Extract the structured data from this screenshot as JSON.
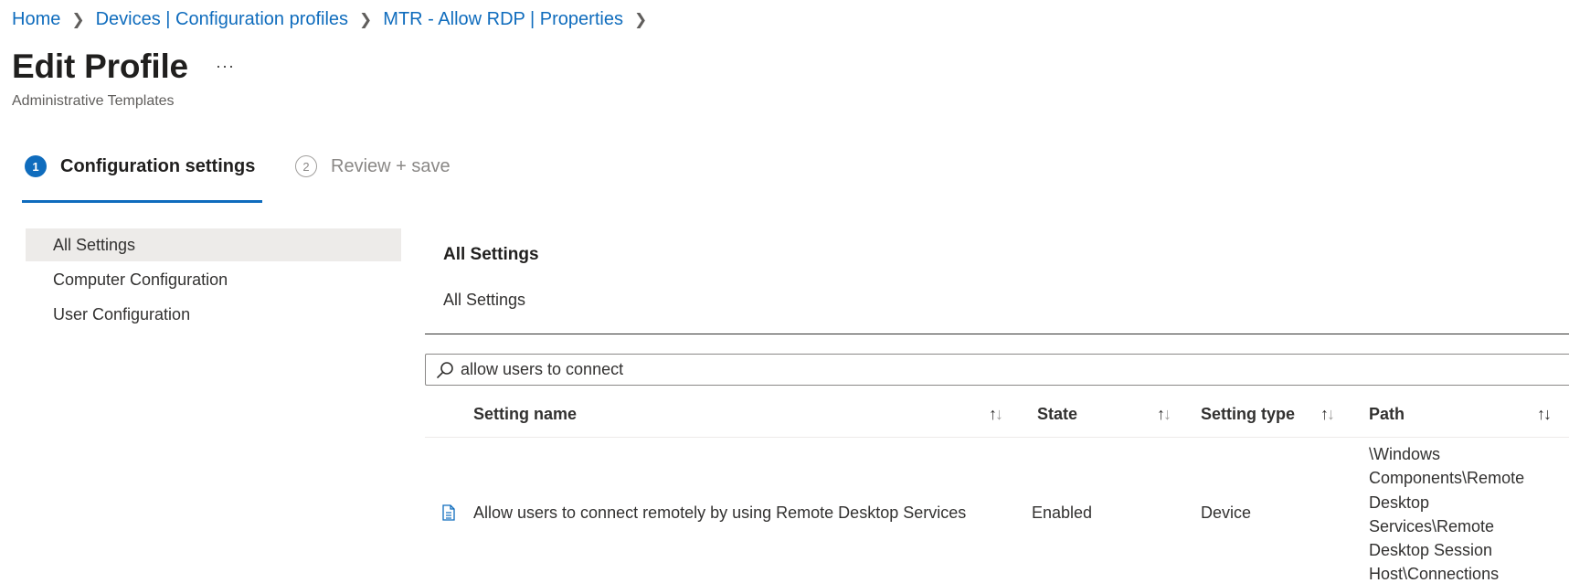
{
  "breadcrumb": [
    {
      "label": "Home"
    },
    {
      "label": "Devices | Configuration profiles"
    },
    {
      "label": "MTR - Allow RDP | Properties"
    }
  ],
  "header": {
    "title": "Edit Profile",
    "more": "···",
    "subtitle": "Administrative Templates"
  },
  "steps": [
    {
      "number": "1",
      "label": "Configuration settings",
      "active": true
    },
    {
      "number": "2",
      "label": "Review + save",
      "active": false
    }
  ],
  "sidebar": {
    "items": [
      {
        "label": "All Settings",
        "selected": true
      },
      {
        "label": "Computer Configuration",
        "selected": false
      },
      {
        "label": "User Configuration",
        "selected": false
      }
    ]
  },
  "main": {
    "title": "All Settings",
    "subtitle": "All Settings"
  },
  "search": {
    "value": "allow users to connect",
    "icon": "search-icon"
  },
  "table": {
    "columns": [
      {
        "label": "Setting name"
      },
      {
        "label": "State"
      },
      {
        "label": "Setting type"
      },
      {
        "label": "Path"
      }
    ],
    "sort_glyph_up": "↑",
    "sort_glyph_down": "↓",
    "rows": [
      {
        "icon": "document-icon",
        "setting_name": "Allow users to connect remotely by using Remote Desktop Services",
        "state": "Enabled",
        "setting_type": "Device",
        "path_lines": [
          "\\Windows",
          "Components\\Remote",
          "Desktop",
          "Services\\Remote",
          "Desktop Session",
          "Host\\Connections"
        ]
      }
    ]
  },
  "colors": {
    "accent": "#0f6cbd",
    "selected_bg": "#edebe9"
  }
}
